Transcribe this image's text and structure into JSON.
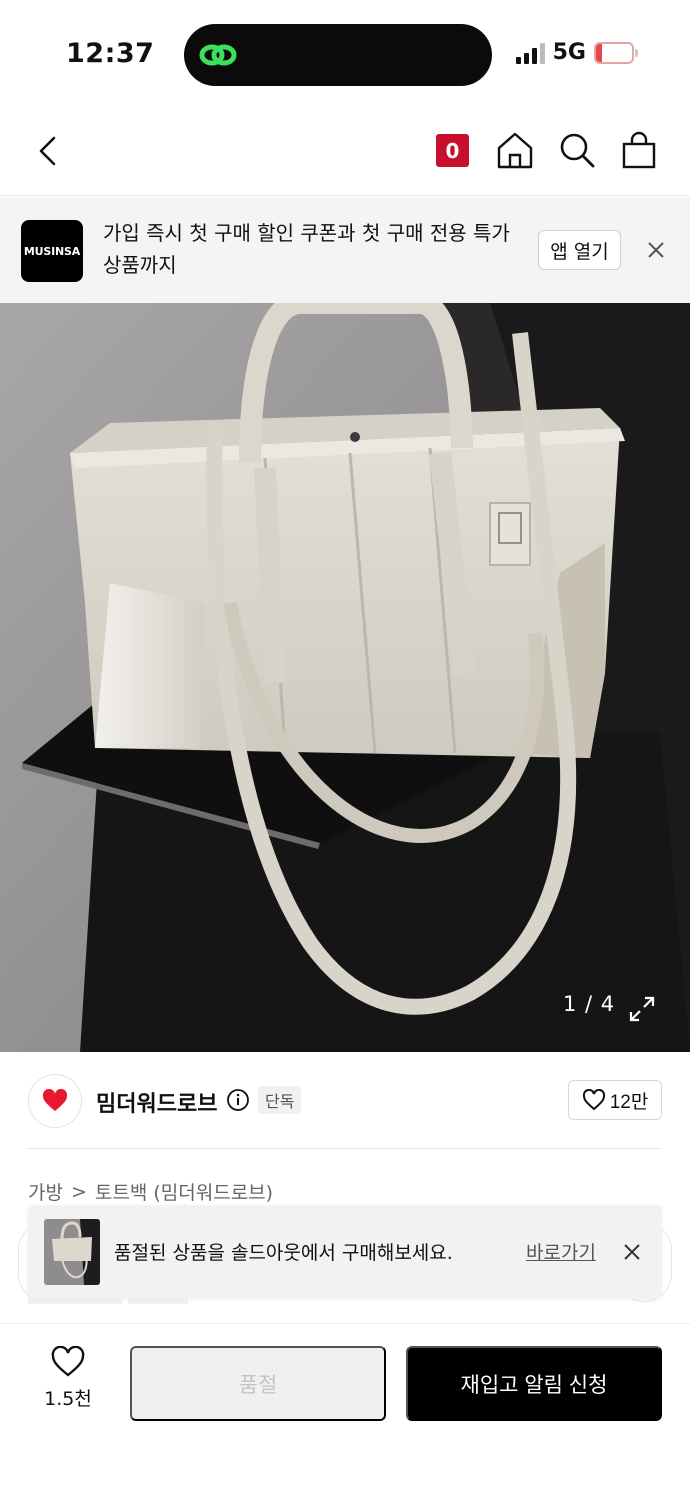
{
  "status_bar": {
    "time": "12:37",
    "network": "5G",
    "battery": "18",
    "battery_level": 0.18
  },
  "nav": {
    "cart_count": "0",
    "icons": [
      "back-icon",
      "home-icon",
      "search-icon",
      "shopping-bag-icon"
    ]
  },
  "app_banner": {
    "logo_text": "MUSINSA",
    "message": "가입 즉시 첫 구매 할인 쿠폰과 첫 구매 전용 특가 상품까지",
    "open_label": "앱 열기"
  },
  "product_image": {
    "counter": "1 / 4"
  },
  "brand": {
    "name": "밈더워드로브",
    "badge": "단독",
    "likes": "12만",
    "heart_color": "#e8192c"
  },
  "breadcrumb": {
    "category": "가방",
    "separator": ">",
    "subcategory": "토트백 (밈더워드로브)"
  },
  "toast": {
    "message": "품절된 상품을 솔드아웃에서 구매해보세요.",
    "link": "바로가기"
  },
  "bottom_bar": {
    "wish_count": "1.5천",
    "soldout_label": "품절",
    "restock_label": "재입고 알림 신청"
  },
  "colors": {
    "accent_red": "#c8102e",
    "primary_black": "#000000",
    "disabled_gray": "#f0f0f0"
  }
}
